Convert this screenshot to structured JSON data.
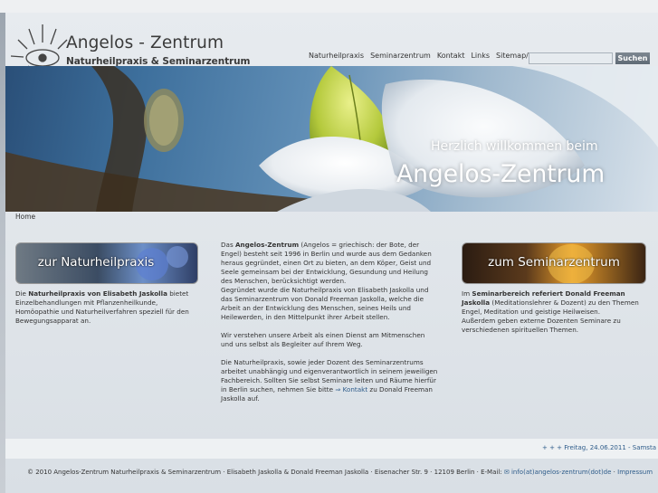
{
  "logo": {
    "title": "Angelos - Zentrum",
    "subtitle": "Naturheilpraxis & Seminarzentrum"
  },
  "nav": {
    "items": [
      "Naturheilpraxis",
      "Seminarzentrum",
      "Kontakt",
      "Links",
      "Sitemap/Hilfe"
    ]
  },
  "search": {
    "button_label": "Suchen",
    "value": ""
  },
  "hero": {
    "welcome": "Herzlich willkommen beim",
    "title": "Angelos-Zentrum"
  },
  "breadcrumb": "Home",
  "banners": {
    "left": "zur Naturheilpraxis",
    "right": "zum Seminarzentrum"
  },
  "left_col": {
    "lead_prefix": "Die ",
    "lead_bold": "Naturheilpraxis von Elisabeth Jaskolla",
    "text": " bietet Einzelbehandlungen mit Pflanzenheilkunde, Homöopathie und Naturheilverfahren speziell für den Bewegungsapparat an."
  },
  "mid_col": {
    "p1_prefix": "Das ",
    "p1_bold": "Angelos-Zentrum",
    "p1_text": " (Angelos = griechisch: der Bote, der Engel) besteht seit 1996 in Berlin und wurde aus dem Gedanken heraus gegründet, einen Ort zu bieten, an dem Köper, Geist und Seele gemeinsam bei der Entwicklung, Gesundung und Heilung des Menschen, berücksichtigt werden.",
    "p1b": "Gegründet wurde die Naturheilpraxis von Elisabeth Jaskolla und das Seminarzentrum von Donald Freeman Jaskolla, welche die Arbeit an der Entwicklung des Menschen, seines Heils und Heilewerden, in den Mittelpunkt ihrer Arbeit stellen.",
    "p2": "Wir verstehen unsere Arbeit als einen Dienst am Mitmenschen und uns selbst als Begleiter auf Ihrem Weg.",
    "p3_text": "Die Naturheilpraxis, sowie jeder Dozent des Seminarzentrums arbeitet unabhängig und eigenverantwortlich in seinem jeweiligen Fachbereich. Sollten Sie selbst Seminare leiten und Räume hierfür in Berlin suchen, nehmen Sie bitte ",
    "p3_link": "Kontakt",
    "p3_suffix": " zu Donald Freeman Jaskolla auf."
  },
  "right_col": {
    "lead_prefix": "Im ",
    "lead_bold": "Seminarbereich referiert Donald Freeman Jaskolla",
    "text": " (Meditationslehrer & Dozent) zu den Themen Engel, Meditation und geistige Heilweisen.",
    "text2": "Außerdem geben externe Dozenten Seminare zu verschiedenen spirituellen Themen."
  },
  "date_ticker": "+ + + Freitag, 24.06.2011 - Samsta",
  "footer": {
    "copyright": "© 2010 Angelos-Zentrum Naturheilpraxis & Seminarzentrum · Elisabeth Jaskolla & Donald Freeman Jaskolla · Eisenacher Str. 9 · 12109 Berlin · E-Mail: ",
    "email": "info(at)angelos-zentrum(dot)de",
    "separator": " · ",
    "impressum": "Impressum"
  },
  "colors": {
    "link": "#2e5c8a",
    "button": "#6b7580"
  }
}
